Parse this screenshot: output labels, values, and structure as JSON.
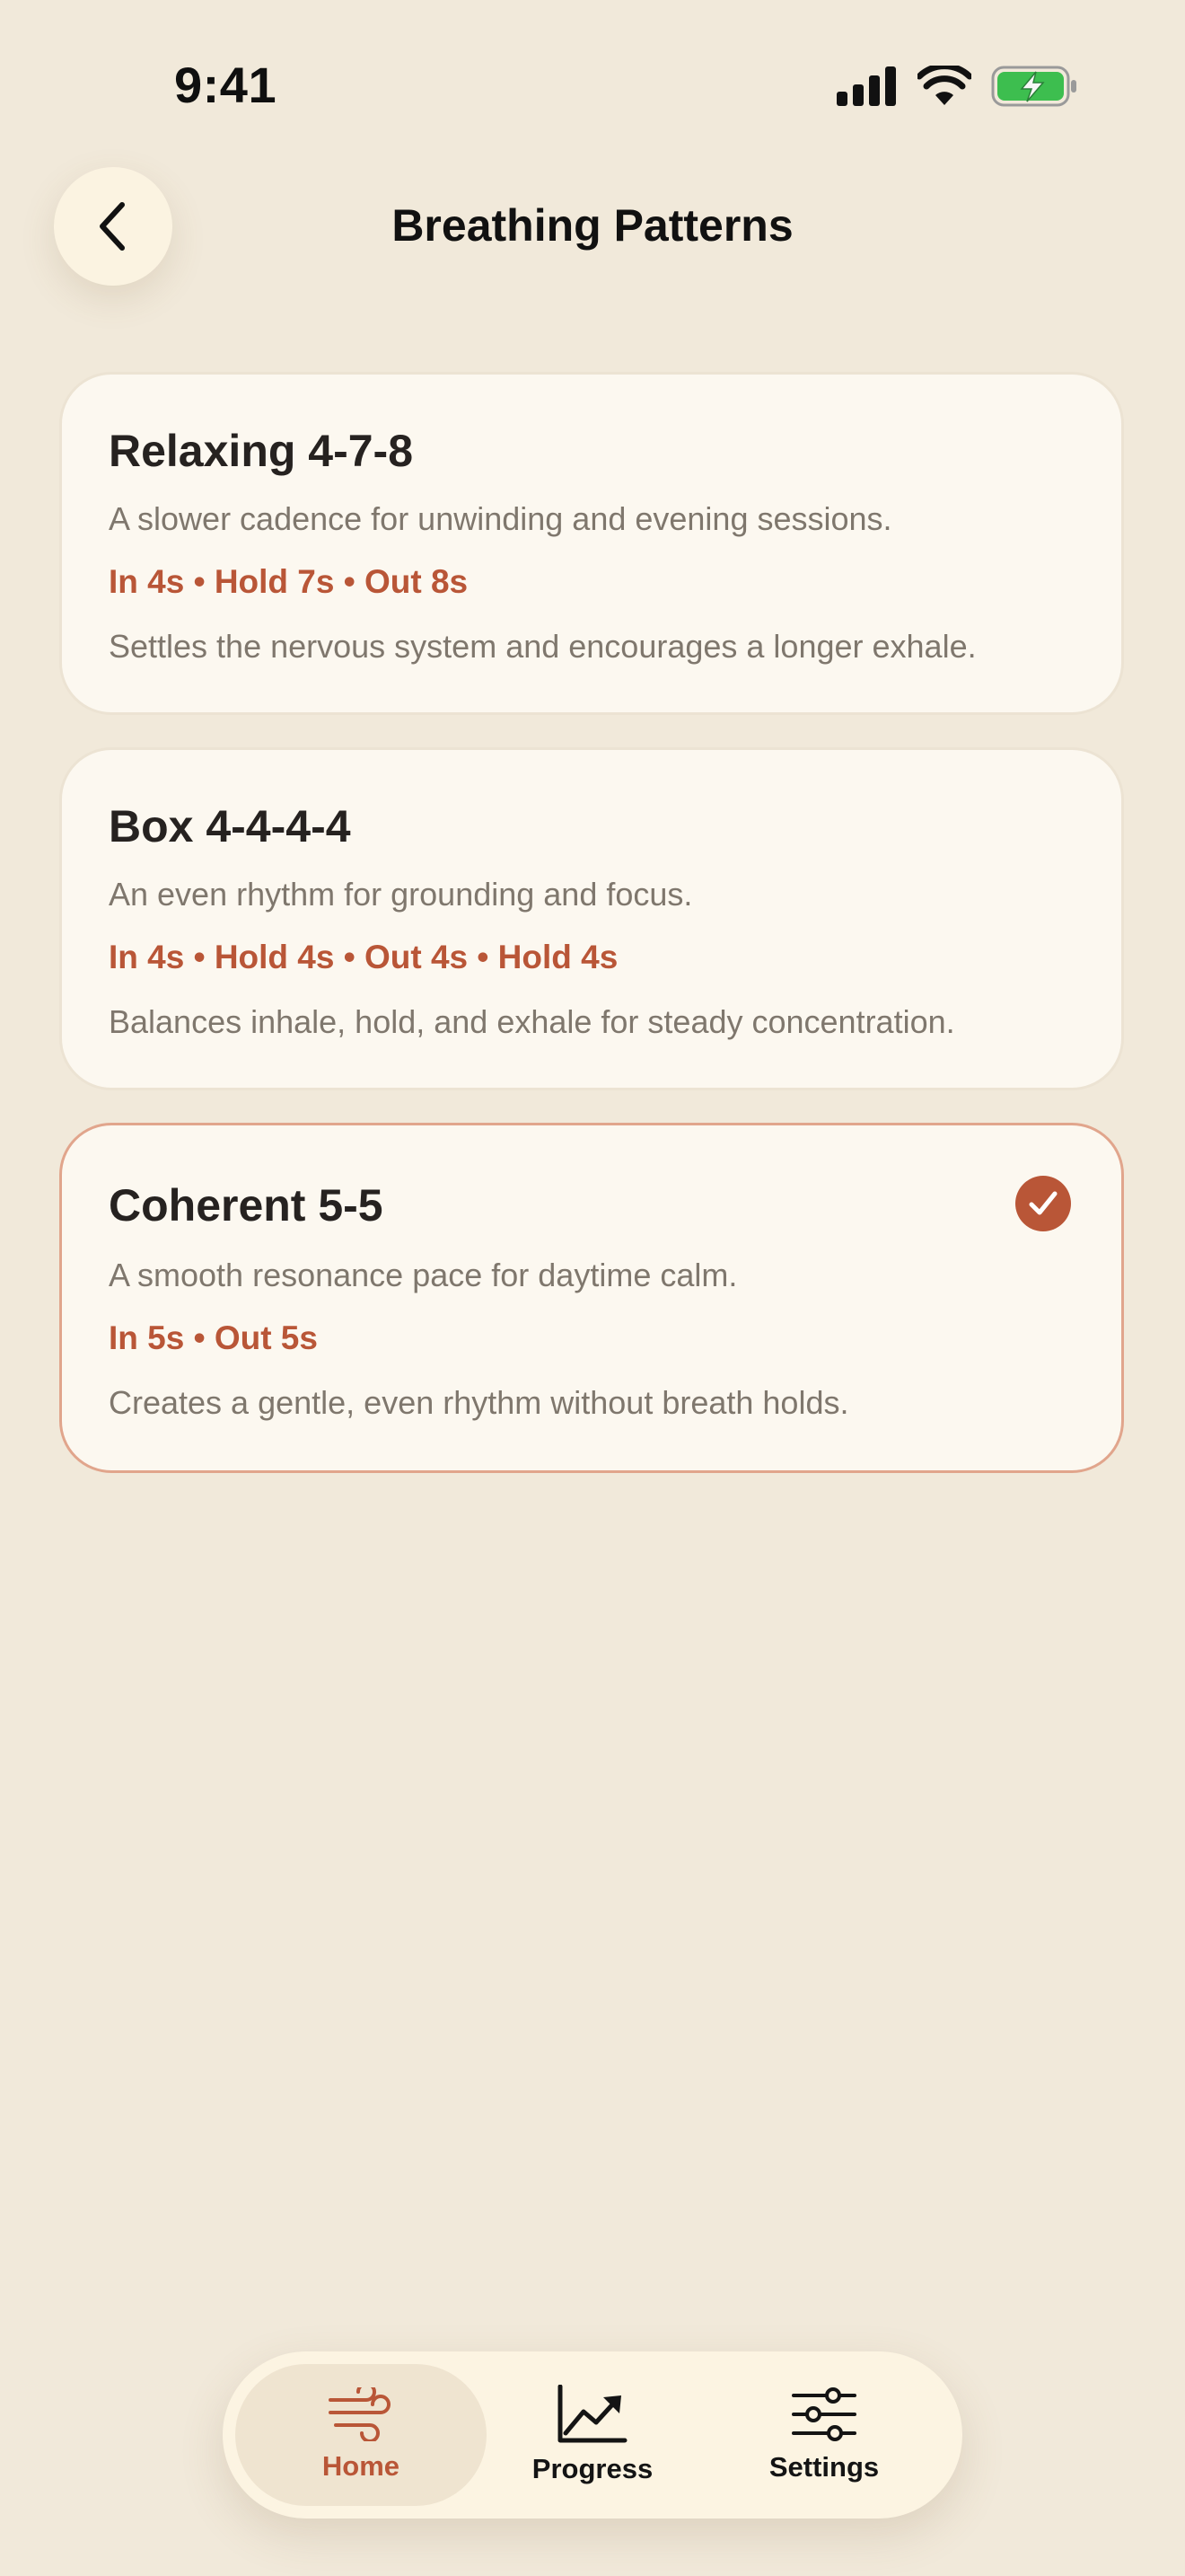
{
  "status_bar": {
    "time": "9:41"
  },
  "header": {
    "title": "Breathing Patterns",
    "back_icon": "chevron-left-icon"
  },
  "patterns": [
    {
      "title": "Relaxing 4-7-8",
      "description": "A slower cadence for unwinding and evening sessions.",
      "timing": "In 4s • Hold 7s • Out 8s",
      "detail": "Settles the nervous system and encourages a longer exhale.",
      "selected": false
    },
    {
      "title": "Box 4-4-4-4",
      "description": "An even rhythm for grounding and focus.",
      "timing": "In 4s • Hold 4s • Out 4s • Hold 4s",
      "detail": "Balances inhale, hold, and exhale for steady concentration.",
      "selected": false
    },
    {
      "title": "Coherent 5-5",
      "description": "A smooth resonance pace for daytime calm.",
      "timing": "In 5s • Out 5s",
      "detail": "Creates a gentle, even rhythm without breath holds.",
      "selected": true
    }
  ],
  "tab_bar": {
    "tabs": [
      {
        "label": "Home",
        "icon": "wind-icon",
        "active": true
      },
      {
        "label": "Progress",
        "icon": "trend-chart-icon",
        "active": false
      },
      {
        "label": "Settings",
        "icon": "sliders-icon",
        "active": false
      }
    ]
  },
  "colors": {
    "background": "#F1E9DA",
    "card": "#FCF8F0",
    "accent": "#B95637",
    "selected_border": "#E1A58C",
    "battery": "#3DBE4F"
  }
}
